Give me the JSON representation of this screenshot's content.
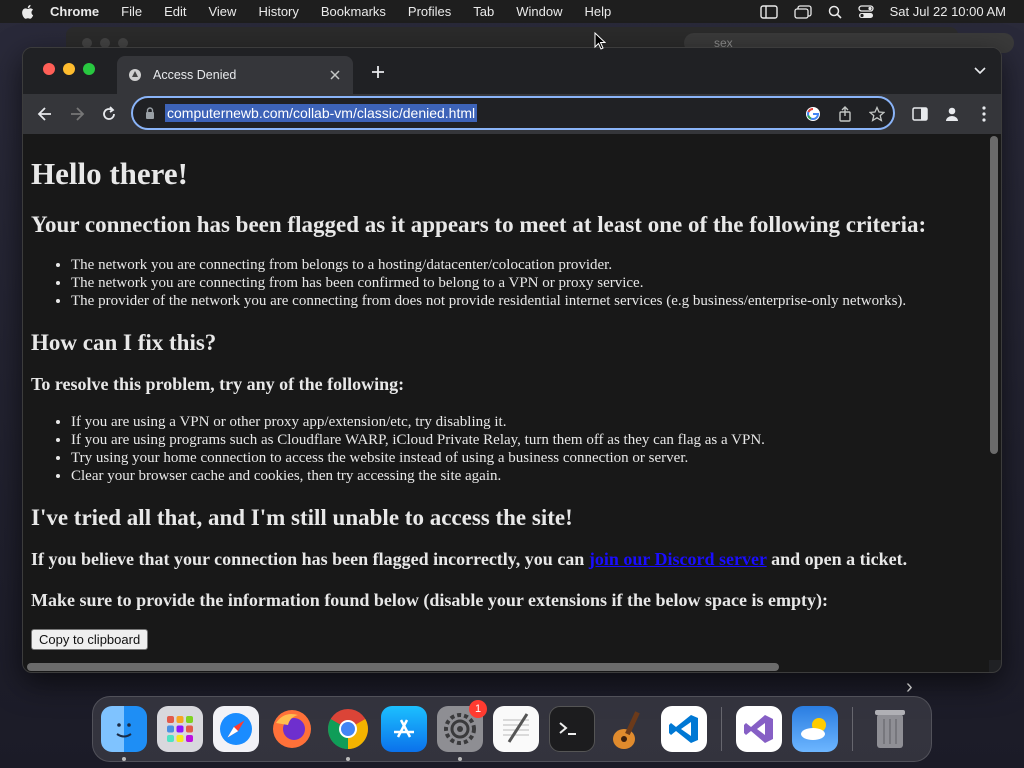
{
  "menubar": {
    "app": "Chrome",
    "items": [
      "File",
      "Edit",
      "View",
      "History",
      "Bookmarks",
      "Profiles",
      "Tab",
      "Window",
      "Help"
    ],
    "clock": "Sat Jul 22  10:00 AM"
  },
  "background_window": {
    "search_text": "sex"
  },
  "browser": {
    "tab_title": "Access Denied",
    "url": "computernewb.com/collab-vm/classic/denied.html"
  },
  "page": {
    "h1": "Hello there!",
    "h2_flagged": "Your connection has been flagged as it appears to meet at least one of the following criteria:",
    "criteria": [
      "The network you are connecting from belongs to a hosting/datacenter/colocation provider.",
      "The network you are connecting from has been confirmed to belong to a VPN or proxy service.",
      "The provider of the network you are connecting from does not provide residential internet services (e.g business/enterprise-only networks)."
    ],
    "h2_fix": "How can I fix this?",
    "h3_resolve": "To resolve this problem, try any of the following:",
    "fixes": [
      "If you are using a VPN or other proxy app/extension/etc, try disabling it.",
      "If you are using programs such as Cloudflare WARP, iCloud Private Relay, turn them off as they can flag as a VPN.",
      "Try using your home connection to access the website instead of using a business connection or server.",
      "Clear your browser cache and cookies, then try accessing the site again."
    ],
    "h2_tried": "I've tried all that, and I'm still unable to access the site!",
    "p_believe_before": "If you believe that your connection has been flagged incorrectly, you can ",
    "p_believe_link": "join our Discord server",
    "p_believe_after": " and open a ticket.",
    "p_provide": "Make sure to provide the information found below (disable your extensions if the below space is empty):",
    "copy_button": "Copy to clipboard"
  },
  "dock": {
    "apps": [
      "finder-icon",
      "launchpad-icon",
      "safari-icon",
      "firefox-icon",
      "chrome-icon",
      "app-store-icon",
      "system-settings-icon",
      "textedit-icon",
      "terminal-icon",
      "garageband-icon",
      "vscode-icon",
      "visual-studio-icon",
      "weather-icon",
      "trash-icon"
    ],
    "settings_badge": "1"
  },
  "colors": {
    "omnibox_border": "#8ab4f8",
    "link": "#1a0dff",
    "page_bg": "#181818"
  }
}
